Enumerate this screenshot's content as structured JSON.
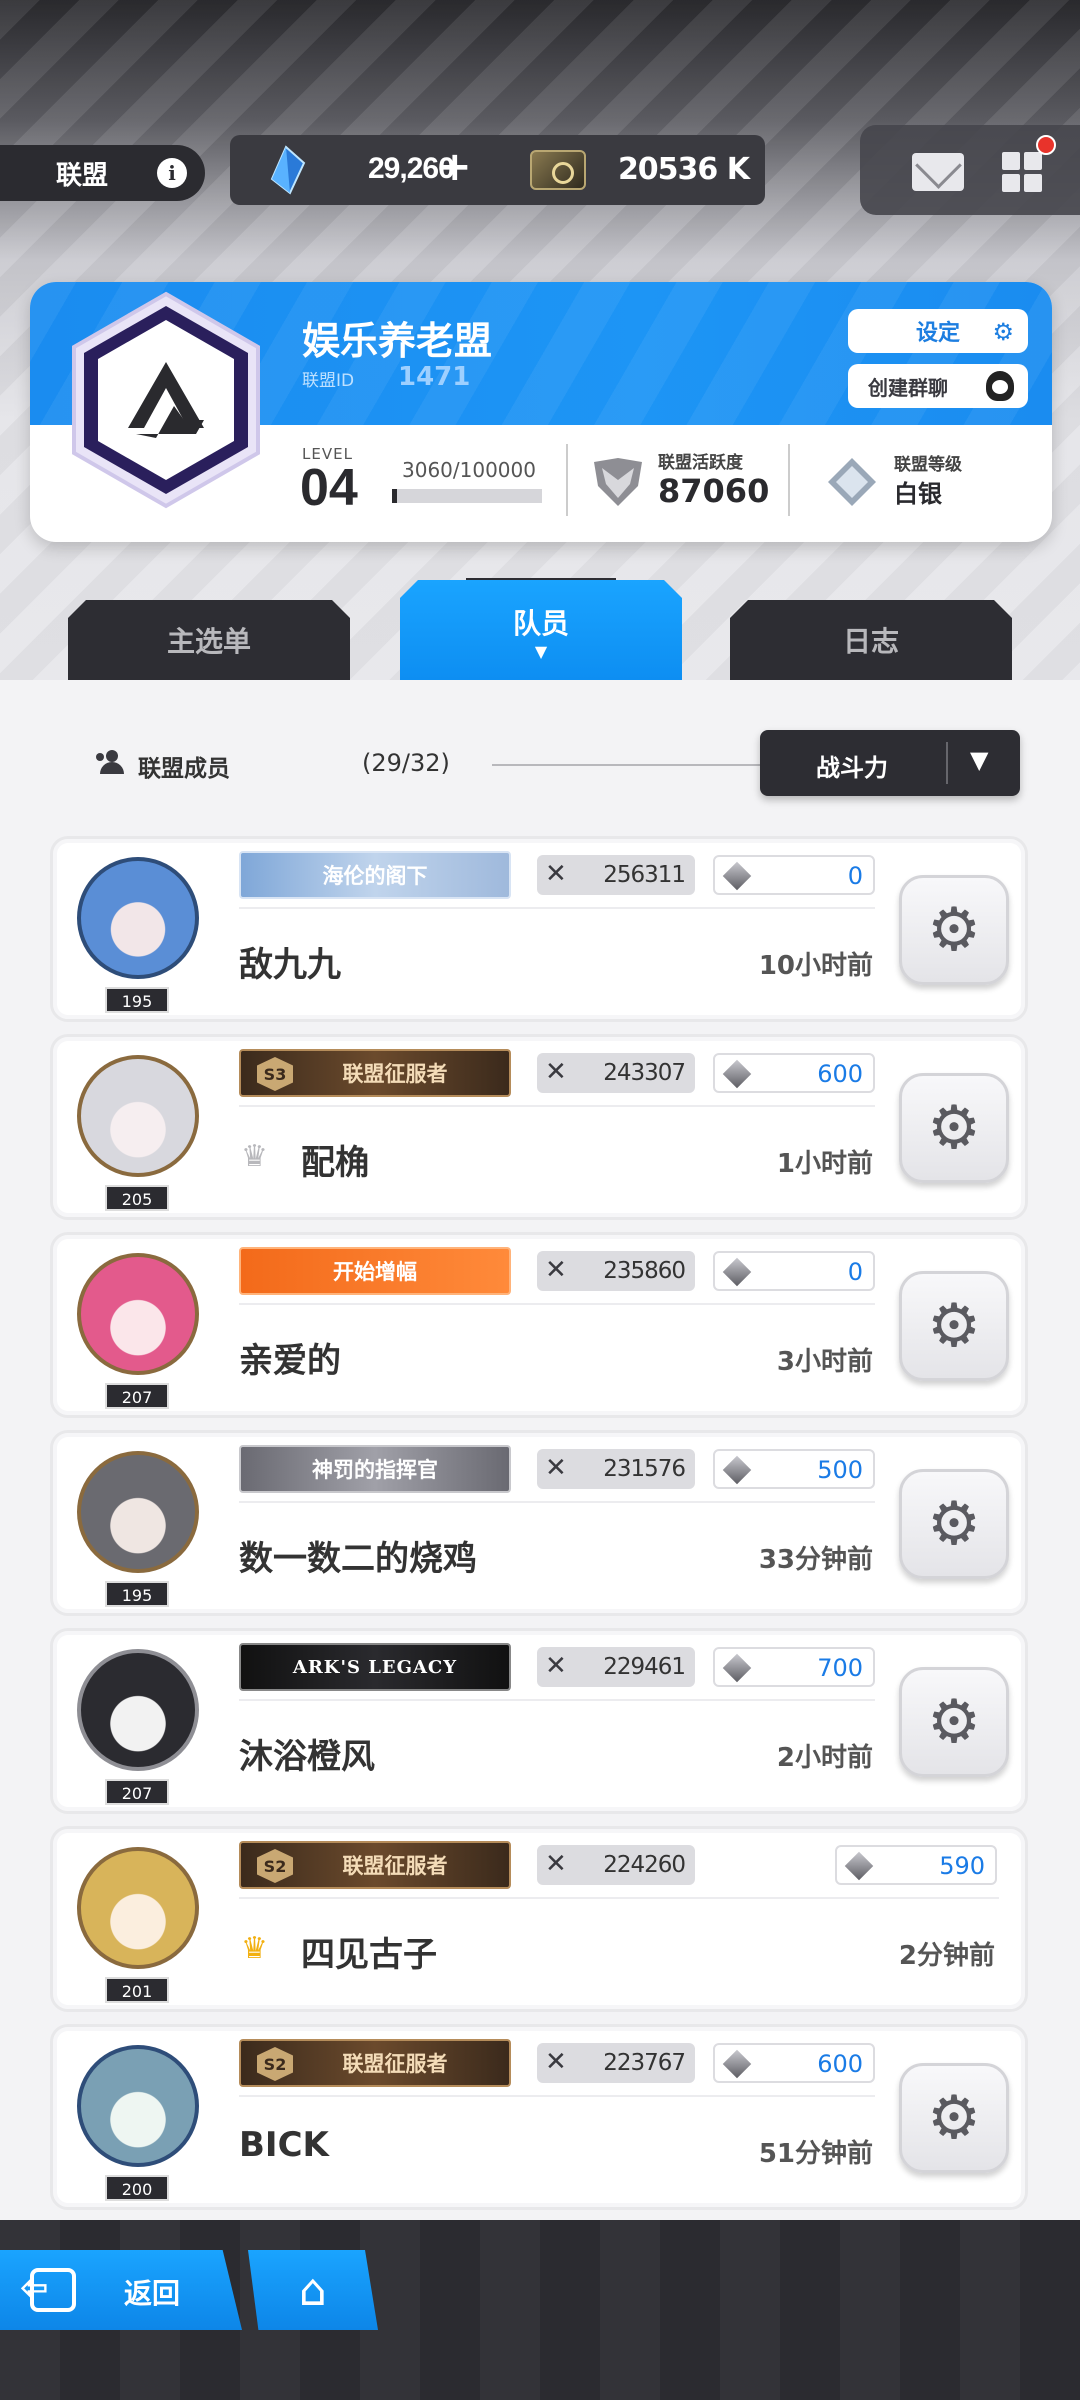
{
  "topbar": {
    "alliance_label": "联盟",
    "info_icon": "info-icon",
    "crystal_value": "29,260",
    "plus": "+",
    "coin_value": "20536 K",
    "icons": [
      "crystal-icon",
      "ticket-icon",
      "mail-icon",
      "grid-menu-icon",
      "notification-dot"
    ]
  },
  "card": {
    "name": "娱乐养老盟",
    "id_label": "联盟ID",
    "id_value": "1471",
    "settings_label": "设定",
    "chat_label": "创建群聊",
    "level_label": "LEVEL",
    "level_value": "04",
    "exp_text": "3060/100000",
    "exp_fraction": 0.0306,
    "activity_label": "联盟活跃度",
    "activity_value": "87060",
    "rank_label": "联盟等级",
    "rank_value": "白银"
  },
  "tabs": {
    "menu": "主选单",
    "members": "队员",
    "log": "日志"
  },
  "members_header": {
    "label": "联盟成员",
    "count": "(29/32)",
    "sort_label": "战斗力"
  },
  "members": [
    {
      "title": "海伦的阁下",
      "power": "256311",
      "contribution": "0",
      "name": "敌九九",
      "last_seen": "10小时前",
      "level": "195"
    },
    {
      "title": "联盟征服者",
      "title_tier": "S3",
      "power": "243307",
      "contribution": "600",
      "name": "配桷",
      "last_seen": "1小时前",
      "level": "205"
    },
    {
      "title": "开始增幅",
      "power": "235860",
      "contribution": "0",
      "name": "亲爱的",
      "last_seen": "3小时前",
      "level": "207"
    },
    {
      "title": "神罚的指挥官",
      "power": "231576",
      "contribution": "500",
      "name": "数一数二的烧鸡",
      "last_seen": "33分钟前",
      "level": "195"
    },
    {
      "title": "ARK'S LEGACY",
      "power": "229461",
      "contribution": "700",
      "name": "沐浴橙风",
      "last_seen": "2小时前",
      "level": "207"
    },
    {
      "title": "联盟征服者",
      "title_tier": "S2",
      "power": "224260",
      "contribution": "590",
      "name": "四见古子",
      "last_seen": "2分钟前",
      "level": "201"
    },
    {
      "title": "联盟征服者",
      "title_tier": "S2",
      "power": "223767",
      "contribution": "600",
      "name": "BICK",
      "last_seen": "51分钟前",
      "level": "200"
    }
  ],
  "bottom_nav": {
    "back_label": "返回",
    "home_icon": "home-icon"
  },
  "colors": {
    "accent_blue": "#1a8cf0",
    "dark": "#2d2d33",
    "contribution_blue": "#1a7be6",
    "leader_crown": "#f2b011"
  }
}
